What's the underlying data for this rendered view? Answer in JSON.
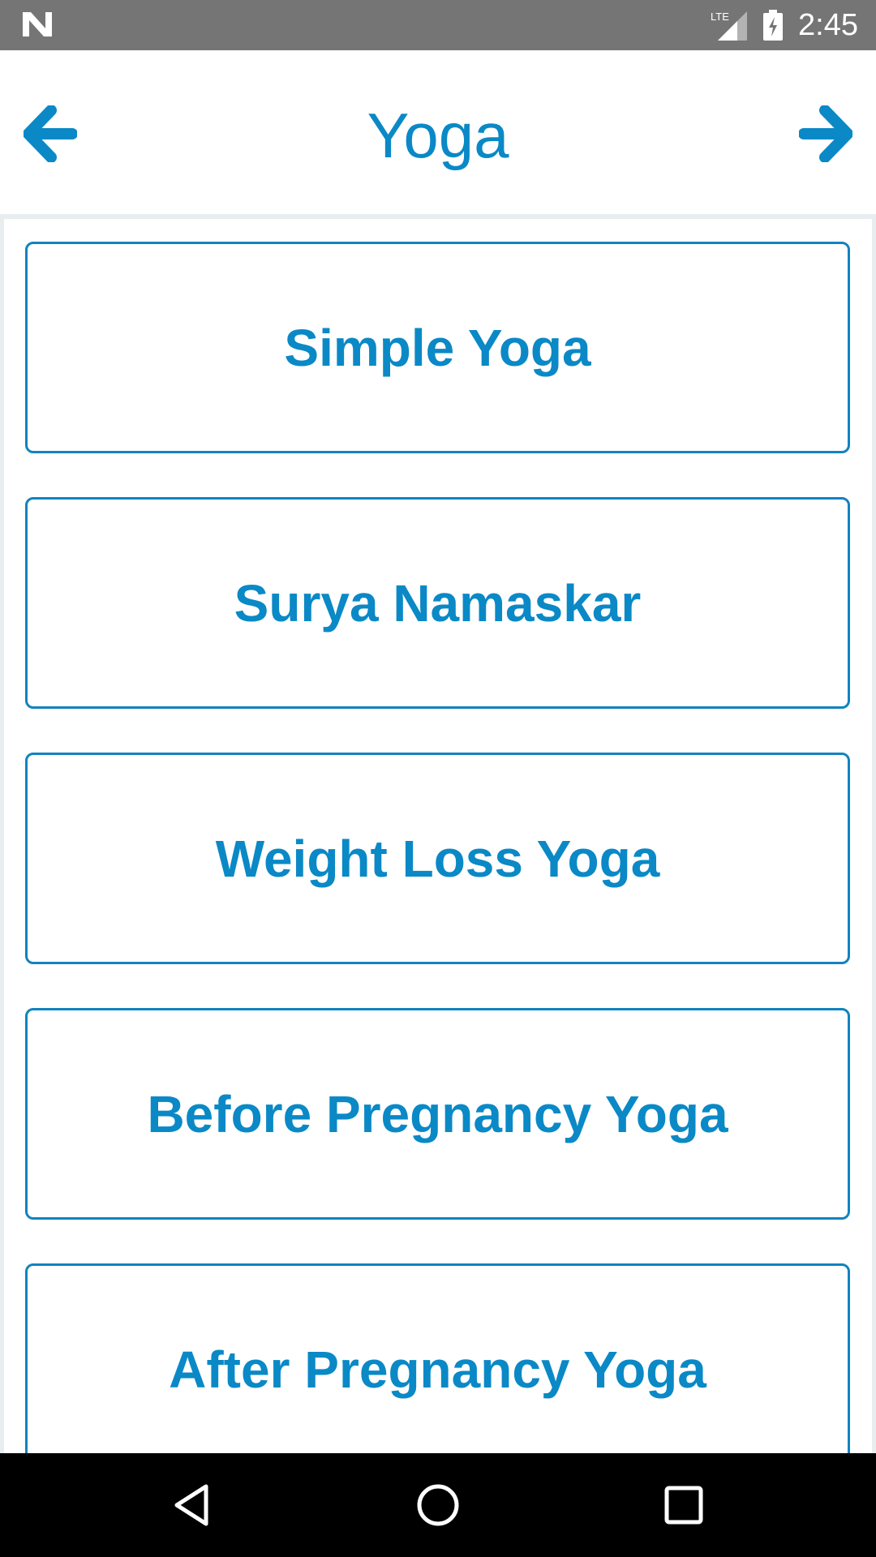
{
  "status_bar": {
    "network_label": "LTE",
    "time": "2:45"
  },
  "toolbar": {
    "title": "Yoga",
    "back_icon": "arrow-left-icon",
    "forward_icon": "arrow-right-icon"
  },
  "categories": [
    {
      "label": "Simple Yoga"
    },
    {
      "label": "Surya Namaskar"
    },
    {
      "label": "Weight Loss Yoga"
    },
    {
      "label": "Before Pregnancy Yoga"
    },
    {
      "label": "After Pregnancy Yoga"
    }
  ],
  "colors": {
    "accent": "#0a89c6",
    "card_border": "#1283bf",
    "status_bar": "#757575",
    "nav_bar": "#000000"
  }
}
